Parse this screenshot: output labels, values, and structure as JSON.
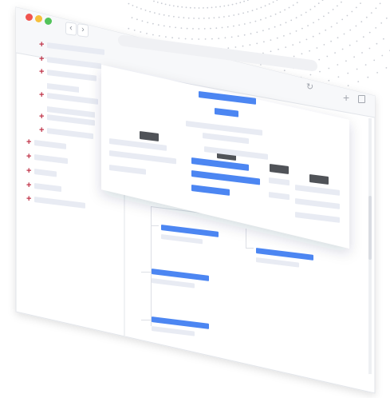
{
  "window": {
    "controls": {
      "close_color": "#f0544f",
      "minimize_color": "#f6bf3c",
      "zoom_color": "#52c35a"
    },
    "nav": {
      "back_glyph": "‹",
      "forward_glyph": "›"
    },
    "toolbar": {
      "reload_glyph": "↻",
      "new_tab_glyph": "+"
    }
  },
  "colors": {
    "accent_blue": "#4c86f2",
    "expand_marker": "#c0354a",
    "placeholder_grey": "#e8ebf3",
    "dark_block": "#505358"
  },
  "sidebar": {
    "items": [
      {
        "marker": "+",
        "icon": "plus-icon"
      },
      {
        "marker": "+",
        "icon": "plus-icon"
      },
      {
        "marker": "+",
        "icon": "plus-icon"
      },
      {
        "marker": "+",
        "icon": "plus-icon"
      },
      {
        "marker": "+",
        "icon": "plus-icon"
      },
      {
        "marker": "+",
        "icon": "plus-icon"
      },
      {
        "marker": "+",
        "icon": "plus-icon"
      },
      {
        "marker": "+",
        "icon": "plus-icon"
      },
      {
        "marker": "+",
        "icon": "plus-icon"
      },
      {
        "marker": "+",
        "icon": "plus-icon"
      },
      {
        "marker": "+",
        "icon": "plus-icon"
      }
    ]
  }
}
